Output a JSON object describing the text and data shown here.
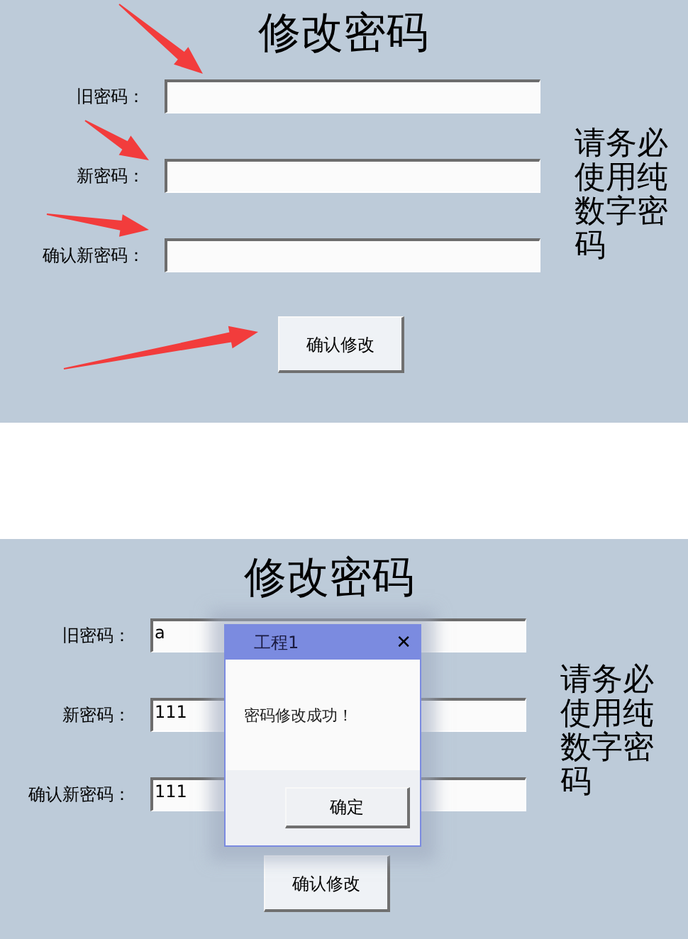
{
  "panels": [
    {
      "title": "修改密码",
      "annotated": true,
      "fields": [
        {
          "label": "旧密码："
        },
        {
          "label": "新密码："
        },
        {
          "label": "确认新密码："
        }
      ],
      "note": "请务必使用纯数字密码",
      "button": "确认修改"
    },
    {
      "title": "修改密码",
      "annotated": false,
      "fields": [
        {
          "label": "旧密码：",
          "value": "a"
        },
        {
          "label": "新密码：",
          "value": "111"
        },
        {
          "label": "确认新密码：",
          "value": "111"
        }
      ],
      "note": "请务必使用纯数字密码",
      "button": "确认修改",
      "dialog": {
        "title": "工程1",
        "close": "✕",
        "message": "密码修改成功！",
        "button": "确定"
      }
    }
  ]
}
